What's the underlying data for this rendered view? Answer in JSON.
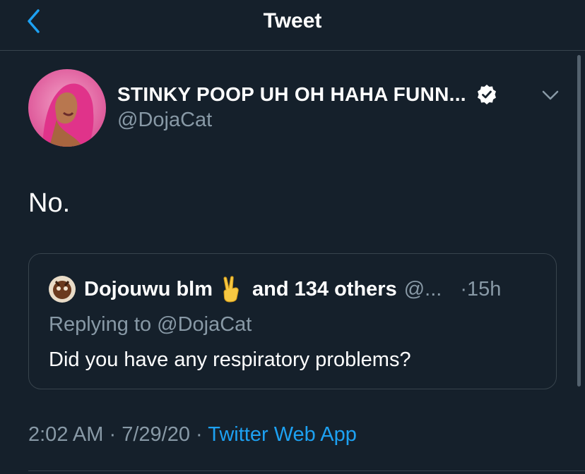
{
  "header": {
    "title": "Tweet",
    "back_icon": "chevron-left-icon",
    "accent": "#1da1f2"
  },
  "tweet": {
    "display_name": "STINKY POOP UH OH HAHA FUNN...",
    "handle": "@DojaCat",
    "verified": true,
    "text": "No.",
    "timestamp_time": "2:02 AM",
    "timestamp_date": "7/29/20",
    "source": "Twitter Web App",
    "separator": "·"
  },
  "quote": {
    "name": "Dojouwu blm",
    "emoji": "victory-hand-emoji",
    "others": "and 134 others",
    "handle": "@...",
    "time": "·15h",
    "replying_to": "Replying to @DojaCat",
    "text": "Did you have any respiratory problems?"
  },
  "colors": {
    "background": "#15202b",
    "text": "#ffffff",
    "secondary_text": "#8899a6",
    "border": "#38444d",
    "link": "#1da1f2"
  }
}
